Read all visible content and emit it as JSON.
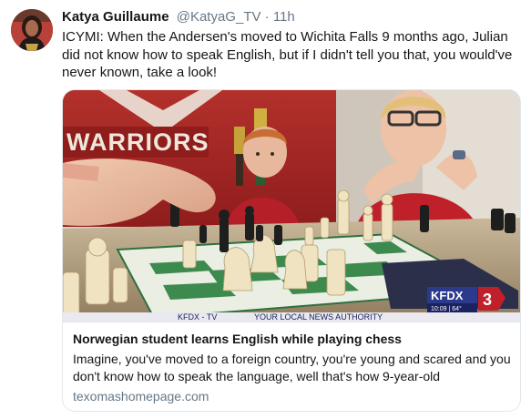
{
  "tweet": {
    "name": "Katya Guillaume",
    "handle": "@KatyaG_TV",
    "separator": "·",
    "time": "11h",
    "text": "ICYMI: When the Andersen's moved to Wichita Falls 9 months ago, Julian did not know how to speak English, but if I didn't tell you that, you would've never known, take a look!"
  },
  "card": {
    "title": "Norwegian student learns English while playing chess",
    "description": "Imagine, you've moved to a foreign country, you're young and scared and you don't know how to speak the language, well that's how 9-year-old",
    "domain": "texomashomepage.com",
    "image": {
      "wall_text": "WARRIORS",
      "station_logo": "KFDX",
      "channel_number": "3",
      "station_time": "10:09 | 64°",
      "ticker_left": "KFDX - TV",
      "ticker_right": "YOUR LOCAL NEWS AUTHORITY"
    }
  },
  "colors": {
    "text": "#14171a",
    "secondary": "#657786",
    "border": "#e1e8ed",
    "wall_red": "#a3201f",
    "shirt_red": "#c0202a",
    "board_green": "#3d8a4e"
  }
}
